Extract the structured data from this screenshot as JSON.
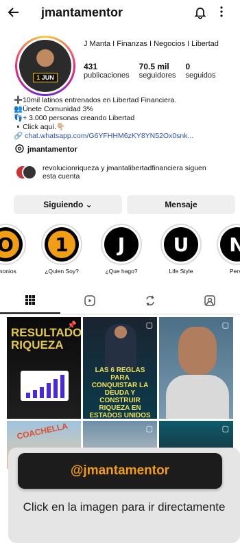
{
  "header": {
    "back_icon": "arrow-left-icon",
    "username": "jmantamentor",
    "bell_icon": "bell-icon",
    "more_icon": "more-vertical-icon"
  },
  "profile": {
    "avatar_badge_num": "1",
    "avatar_badge_text": "JUN",
    "display_name": "J Manta I Finanzas I Negocios I Libertad",
    "posts": {
      "value": "431",
      "label": "publicaciones"
    },
    "followers": {
      "value": "70.5 mil",
      "label": "seguidores"
    },
    "following": {
      "value": "0",
      "label": "seguidos"
    }
  },
  "bio": {
    "line1": "➕10mil latinos entrenados en Libertad Financiera.",
    "line2": "👥Únete Comunidad 3%",
    "line3": "👣+ 3.000 personas creando Libertad",
    "line4": "▪️Click aquí.👇🏼",
    "link": "chat.whatsapp.com/G6YFHHM6zKY8YN52Ox0snk...",
    "threads": "jmantamentor"
  },
  "followed_by": "revolucionriqueza y jmantalibertadfinanciera siguen esta cuenta",
  "buttons": {
    "following": "Siguiendo ⌄",
    "message": "Mensaje"
  },
  "highlights": [
    {
      "glyph": "O",
      "label": "timonios"
    },
    {
      "glyph": "1",
      "label": "¿Quien Soy?"
    },
    {
      "glyph": "J",
      "label": "¿Que hago?"
    },
    {
      "glyph": "U",
      "label": "Life Style"
    },
    {
      "glyph": "N",
      "label": "Perso"
    }
  ],
  "tabs": [
    "grid-icon",
    "reels-icon",
    "tagged-reposts-icon",
    "tagged-user-icon"
  ],
  "posts": {
    "p1_title": "RESULTADOS RIQUEZA",
    "p2_title": "LAS 6 REGLAS PARA CONQUISTAR LA DEUDA Y CONSTRUIR RIQUEZA EN ESTADOS UNIDOS",
    "p4_title": "COACHELLA"
  },
  "overlay": {
    "handle": "@jmantamentor",
    "cta": "Click en la imagen para ir directamente"
  },
  "colors": {
    "accent_orange": "#f29b16",
    "link_blue": "#2b4fb8",
    "button_bg": "#efefef"
  }
}
